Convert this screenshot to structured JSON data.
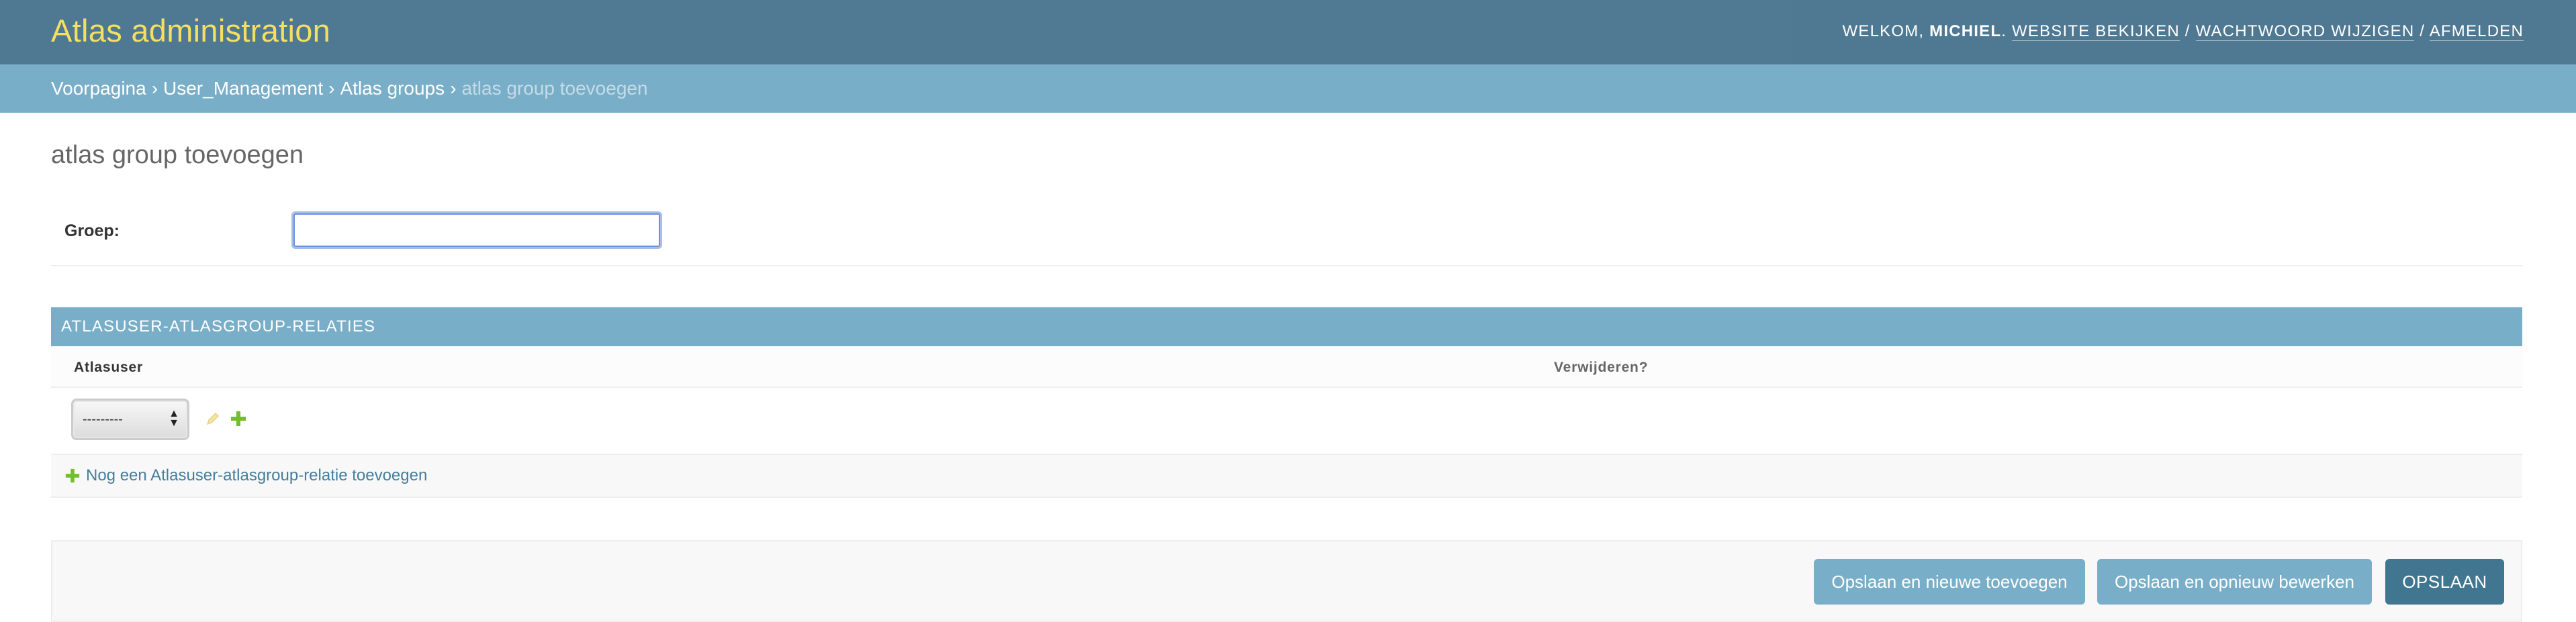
{
  "header": {
    "branding": "Atlas administration",
    "welcome": "Welkom,",
    "username": "Michiel",
    "links": [
      "Website bekijken",
      "Wachtwoord wijzigen",
      "Afmelden"
    ],
    "link_separator": "/"
  },
  "breadcrumbs": {
    "items": [
      "Voorpagina",
      "User_Management",
      "Atlas groups"
    ],
    "current": "atlas group toevoegen",
    "separator": "›"
  },
  "page": {
    "title": "atlas group toevoegen"
  },
  "form": {
    "group_label": "Groep:",
    "group_value": ""
  },
  "inline": {
    "title": "Atlasuser-atlasgroup-relaties",
    "columns": [
      "Atlasuser",
      "Verwijderen?"
    ],
    "select_value": "---------",
    "add_link": "Nog een Atlasuser-atlasgroup-relatie toevoegen"
  },
  "submit": {
    "save_add": "Opslaan en nieuwe toevoegen",
    "save_continue": "Opslaan en opnieuw bewerken",
    "save": "Opslaan"
  },
  "colors": {
    "header_bg": "#417690",
    "branding": "#f5dd5d",
    "breadcrumb_bg": "#79aec8",
    "primary_button": "#417690",
    "secondary_button": "#79aec8",
    "link": "#447e9b",
    "add_icon": "#70bf2b"
  },
  "icons": [
    "pencil-icon",
    "plus-icon"
  ]
}
